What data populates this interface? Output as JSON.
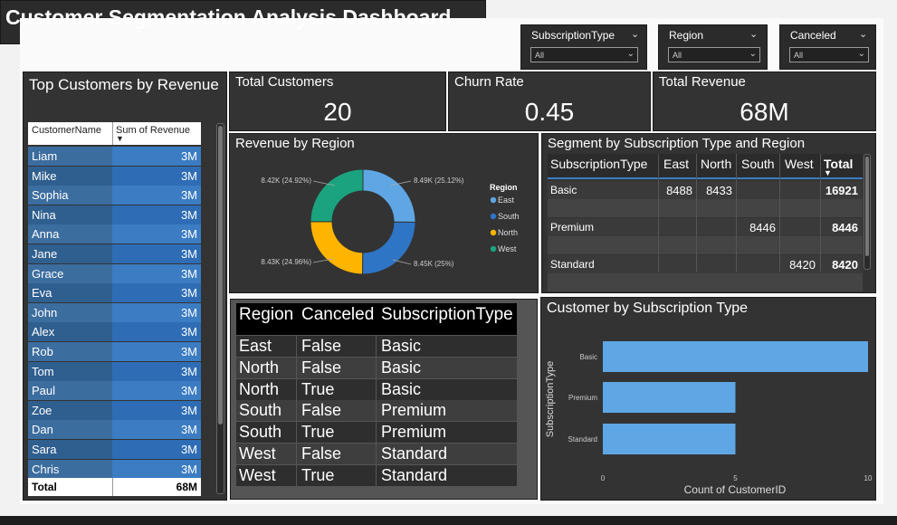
{
  "title": "Customer Segmentation Analysis Dashboard",
  "slicers": [
    {
      "label": "SubscriptionType",
      "value": "All"
    },
    {
      "label": "Region",
      "value": "All"
    },
    {
      "label": "Canceled",
      "value": "All"
    }
  ],
  "kpis": {
    "total_customers": {
      "label": "Total Customers",
      "value": "20"
    },
    "churn_rate": {
      "label": "Churn Rate",
      "value": "0.45"
    },
    "total_revenue": {
      "label": "Total Revenue",
      "value": "68M"
    }
  },
  "top_customers": {
    "title": "Top Customers by Revenue",
    "col_name": "CustomerName",
    "col_revenue": "Sum of Revenue",
    "rows": [
      {
        "name": "Liam",
        "revenue": "3M"
      },
      {
        "name": "Mike",
        "revenue": "3M"
      },
      {
        "name": "Sophia",
        "revenue": "3M"
      },
      {
        "name": "Nina",
        "revenue": "3M"
      },
      {
        "name": "Anna",
        "revenue": "3M"
      },
      {
        "name": "Jane",
        "revenue": "3M"
      },
      {
        "name": "Grace",
        "revenue": "3M"
      },
      {
        "name": "Eva",
        "revenue": "3M"
      },
      {
        "name": "John",
        "revenue": "3M"
      },
      {
        "name": "Alex",
        "revenue": "3M"
      },
      {
        "name": "Rob",
        "revenue": "3M"
      },
      {
        "name": "Tom",
        "revenue": "3M"
      },
      {
        "name": "Paul",
        "revenue": "3M"
      },
      {
        "name": "Zoe",
        "revenue": "3M"
      },
      {
        "name": "Dan",
        "revenue": "3M"
      },
      {
        "name": "Sara",
        "revenue": "3M"
      },
      {
        "name": "Chris",
        "revenue": "3M"
      }
    ],
    "total_label": "Total",
    "total_value": "68M"
  },
  "region_table": {
    "headers": [
      "Region",
      "Canceled",
      "SubscriptionType"
    ],
    "rows": [
      [
        "East",
        "False",
        "Basic"
      ],
      [
        "North",
        "False",
        "Basic"
      ],
      [
        "North",
        "True",
        "Basic"
      ],
      [
        "South",
        "False",
        "Premium"
      ],
      [
        "South",
        "True",
        "Premium"
      ],
      [
        "West",
        "False",
        "Standard"
      ],
      [
        "West",
        "True",
        "Standard"
      ]
    ]
  },
  "segment_matrix": {
    "title": "Segment by Subscription Type and Region",
    "headers": [
      "SubscriptionType",
      "East",
      "North",
      "South",
      "West",
      "Total"
    ],
    "rows": [
      [
        "Basic",
        "8488",
        "8433",
        "",
        "",
        "16921"
      ],
      [
        "Premium",
        "",
        "",
        "8446",
        "",
        "8446"
      ],
      [
        "Standard",
        "",
        "",
        "",
        "8420",
        "8420"
      ]
    ]
  },
  "colors": {
    "east": "#5ea7e4",
    "south": "#2e75c6",
    "north": "#ffb500",
    "west": "#1aa37e",
    "bar": "#5ea7e4",
    "panel": "#333333"
  },
  "chart_data": [
    {
      "type": "pie",
      "title": "Revenue by Region",
      "legend_title": "Region",
      "legend_position": "right",
      "categories": [
        "East",
        "South",
        "North",
        "West"
      ],
      "values": [
        8490,
        8450,
        8430,
        8420
      ],
      "data_labels": [
        "8.49K (25.12%)",
        "8.45K (25%)",
        "8.43K (24.96%)",
        "8.42K (24.92%)"
      ]
    },
    {
      "type": "bar",
      "orientation": "horizontal",
      "title": "Customer by Subscription Type",
      "categories": [
        "Basic",
        "Premium",
        "Standard"
      ],
      "values": [
        10,
        5,
        5
      ],
      "xlabel": "Count of CustomerID",
      "ylabel": "SubscriptionType",
      "xlim": [
        0,
        10
      ],
      "xticks": [
        "0",
        "5",
        "10"
      ]
    }
  ]
}
